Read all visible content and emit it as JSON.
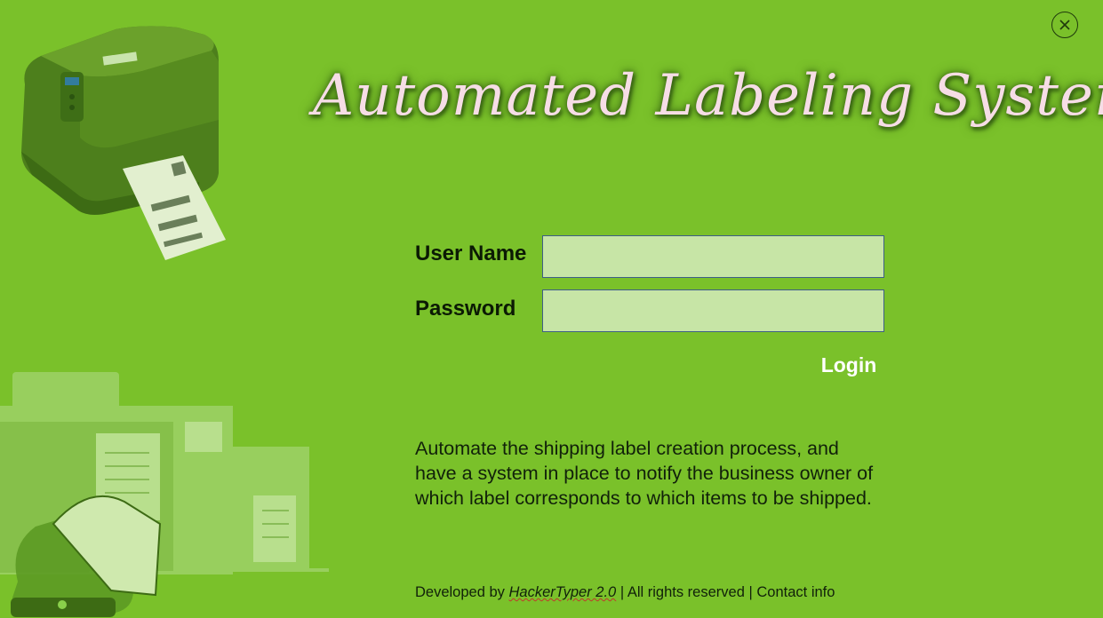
{
  "window": {
    "title": "Automated Labeling System",
    "close_icon": "close-circle-icon"
  },
  "login_form": {
    "username_label": "User Name",
    "username_value": "",
    "password_label": "Password",
    "password_value": "",
    "login_label": "Login"
  },
  "description": {
    "line1": "Automate the shipping label creation process, and",
    "line2": "have a system in place to notify the business owner of",
    "line3": "which label corresponds to which items to be shipped."
  },
  "footer": {
    "developed_by": "Developed by",
    "developer": "HackerTyper 2.0",
    "sep1": "|",
    "rights": "All rights reserved",
    "sep2": "|",
    "contact": "Contact info"
  },
  "illustrations": {
    "printer": "label-printer-illustration",
    "boxes": "shipping-boxes-illustration"
  },
  "colors": {
    "background": "#7ac12a",
    "input_fill": "#c7e5a6",
    "title_text": "#f6dde6"
  }
}
